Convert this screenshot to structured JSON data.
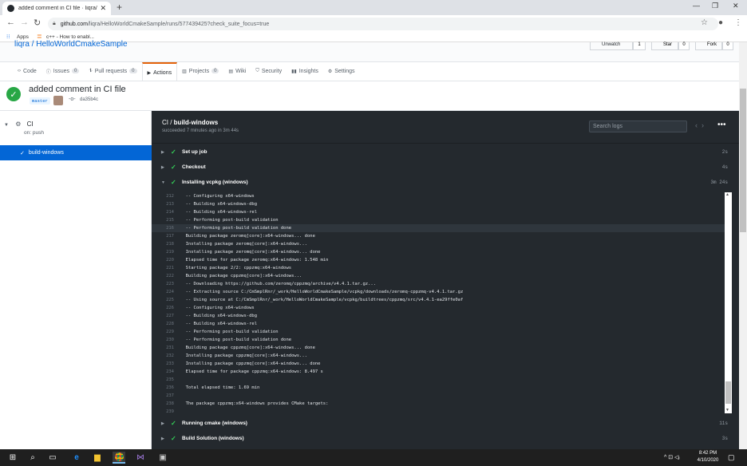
{
  "browser": {
    "tab_title": "added comment in CI file · liqra/",
    "new_tab": "+",
    "url_domain": "github.com",
    "url_path": "/liqra/HelloWorldCmakeSample/runs/577439425?check_suite_focus=true",
    "bookmarks": [
      {
        "label": "Apps"
      },
      {
        "label": "c++ - How to enabl..."
      }
    ]
  },
  "repo": {
    "breadcrumb": "liqra / HelloWorldCmakeSample",
    "buttons": [
      "Unwatch",
      "1",
      "Star",
      "0",
      "Fork",
      "0"
    ]
  },
  "nav_tabs": [
    {
      "label": "Code",
      "count": null,
      "icon": "code-icon"
    },
    {
      "label": "Issues",
      "count": "0",
      "icon": "issue-icon"
    },
    {
      "label": "Pull requests",
      "count": "0",
      "icon": "pr-icon"
    },
    {
      "label": "Actions",
      "count": null,
      "icon": "play-icon",
      "selected": true
    },
    {
      "label": "Projects",
      "count": "0",
      "icon": "project-icon"
    },
    {
      "label": "Wiki",
      "count": null,
      "icon": "book-icon"
    },
    {
      "label": "Security",
      "count": null,
      "icon": "shield-icon"
    },
    {
      "label": "Insights",
      "count": null,
      "icon": "graph-icon"
    },
    {
      "label": "Settings",
      "count": null,
      "icon": "gear-icon"
    }
  ],
  "run": {
    "title": "added comment in CI file",
    "branch": "master",
    "commit": "da35b4c"
  },
  "sidebar": {
    "workflow": "CI",
    "trigger": "on: push",
    "job": "build-windows"
  },
  "job_panel": {
    "title_prefix": "CI / ",
    "title_job": "build-windows",
    "subtitle": "succeeded 7 minutes ago in 3m 44s",
    "search_placeholder": "Search logs"
  },
  "steps_top": [
    {
      "label": "Set up job",
      "duration": "2s",
      "expanded": false
    },
    {
      "label": "Checkout",
      "duration": "4s",
      "expanded": false
    },
    {
      "label": "Installing vcpkg (windows)",
      "duration": "3m 24s",
      "expanded": true
    }
  ],
  "log_lines": [
    {
      "n": "212",
      "t": "  -- Configuring x64-windows"
    },
    {
      "n": "213",
      "t": "  -- Building x64-windows-dbg"
    },
    {
      "n": "214",
      "t": "  -- Building x64-windows-rel"
    },
    {
      "n": "215",
      "t": "  -- Performing post-build validation"
    },
    {
      "n": "216",
      "t": "  -- Performing post-build validation done",
      "hl": true
    },
    {
      "n": "217",
      "t": "  Building package zeromq[core]:x64-windows... done"
    },
    {
      "n": "218",
      "t": "  Installing package zeromq[core]:x64-windows..."
    },
    {
      "n": "219",
      "t": "  Installing package zeromq[core]:x64-windows... done"
    },
    {
      "n": "220",
      "t": "  Elapsed time for package zeromq:x64-windows: 1.548 min"
    },
    {
      "n": "221",
      "t": "  Starting package 2/2: cppzmq:x64-windows"
    },
    {
      "n": "222",
      "t": "  Building package cppzmq[core]:x64-windows..."
    },
    {
      "n": "223",
      "t": "  -- Downloading https://github.com/zeromq/cppzmq/archive/v4.4.1.tar.gz..."
    },
    {
      "n": "224",
      "t": "  -- Extracting source C:/CmSmplRnr/_work/HelloWorldCmakeSample/vcpkg/downloads/zeromq-cppzmq-v4.4.1.tar.gz"
    },
    {
      "n": "225",
      "t": "  -- Using source at C:/CmSmplRnr/_work/HelloWorldCmakeSample/vcpkg/buildtrees/cppzmq/src/v4.4.1-ea29ffe0af"
    },
    {
      "n": "226",
      "t": "  -- Configuring x64-windows"
    },
    {
      "n": "227",
      "t": "  -- Building x64-windows-dbg"
    },
    {
      "n": "228",
      "t": "  -- Building x64-windows-rel"
    },
    {
      "n": "229",
      "t": "  -- Performing post-build validation"
    },
    {
      "n": "230",
      "t": "  -- Performing post-build validation done"
    },
    {
      "n": "231",
      "t": "  Building package cppzmq[core]:x64-windows... done"
    },
    {
      "n": "232",
      "t": "  Installing package cppzmq[core]:x64-windows..."
    },
    {
      "n": "233",
      "t": "  Installing package cppzmq[core]:x64-windows... done"
    },
    {
      "n": "234",
      "t": "  Elapsed time for package cppzmq:x64-windows: 8.497 s"
    },
    {
      "n": "235",
      "t": ""
    },
    {
      "n": "236",
      "t": "  Total elapsed time: 1.69 min"
    },
    {
      "n": "237",
      "t": ""
    },
    {
      "n": "238",
      "t": "  The package cppzmq:x64-windows provides CMake targets:"
    },
    {
      "n": "239",
      "t": ""
    }
  ],
  "steps_bottom": [
    {
      "label": "Running cmake (windows)",
      "duration": "11s"
    },
    {
      "label": "Build Solution (windows)",
      "duration": "3s"
    }
  ],
  "taskbar": {
    "time": "8:42 PM",
    "date": "4/10/2020"
  },
  "colors": {
    "accent": "#0366d6",
    "success": "#28a745",
    "log_bg": "#24292e",
    "tab_underline": "#e36209"
  }
}
